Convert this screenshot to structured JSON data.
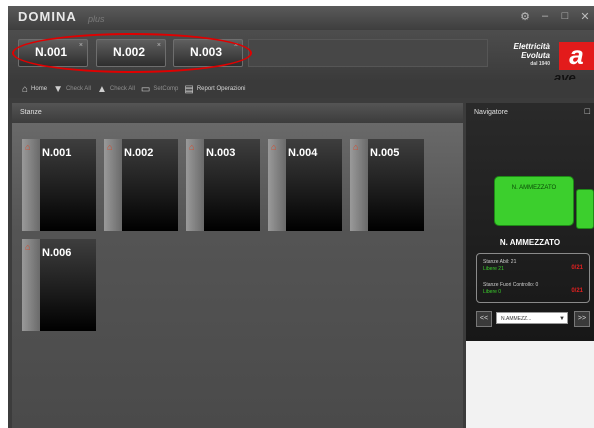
{
  "app": {
    "title": "DOMINA",
    "subtitle": "plus",
    "window_buttons": [
      "⚙",
      "–",
      "□",
      "✕"
    ]
  },
  "floor_tabs": [
    {
      "label": "N.001",
      "close": "×"
    },
    {
      "label": "N.002",
      "close": "×"
    },
    {
      "label": "N.003",
      "close": "×"
    }
  ],
  "brand": {
    "line1": "Elettricità",
    "line2": "Evoluta",
    "line3": "dal 1940",
    "logo_letter": "a",
    "logo_word": "ave"
  },
  "toolbar": {
    "items": [
      {
        "icon": "home-icon",
        "label": "Home"
      },
      {
        "icon": "down-icon",
        "label": "Check All"
      },
      {
        "icon": "up-icon",
        "label": "Check All"
      },
      {
        "icon": "monitor-icon",
        "label": "SetComp"
      },
      {
        "icon": "report-icon",
        "label": "Report Operazioni"
      }
    ]
  },
  "left_panel": {
    "title": "Stanze"
  },
  "rooms": [
    {
      "label": "N.001"
    },
    {
      "label": "N.002"
    },
    {
      "label": "N.003"
    },
    {
      "label": "N.004"
    },
    {
      "label": "N.005"
    },
    {
      "label": "N.006"
    }
  ],
  "navigator": {
    "title": "Navigatore",
    "close": "□",
    "map_room_label": "N. AMMEZZATO",
    "floor_name": "N. AMMEZZATO",
    "info": {
      "line1": "Stanze Abil: 21",
      "line1_green": "Libere 21",
      "line1_red": "0/21",
      "line2": "Stanze Fuori Controllo: 0",
      "line2_green": "Libere 0",
      "line2_red": "0/21"
    },
    "prev": "<<",
    "next": ">>",
    "select_value": "N.AMMEZZ..."
  },
  "colors": {
    "accent_red": "#e00000",
    "room_green": "#3ccf2d",
    "brand_red": "#e31b1b"
  }
}
